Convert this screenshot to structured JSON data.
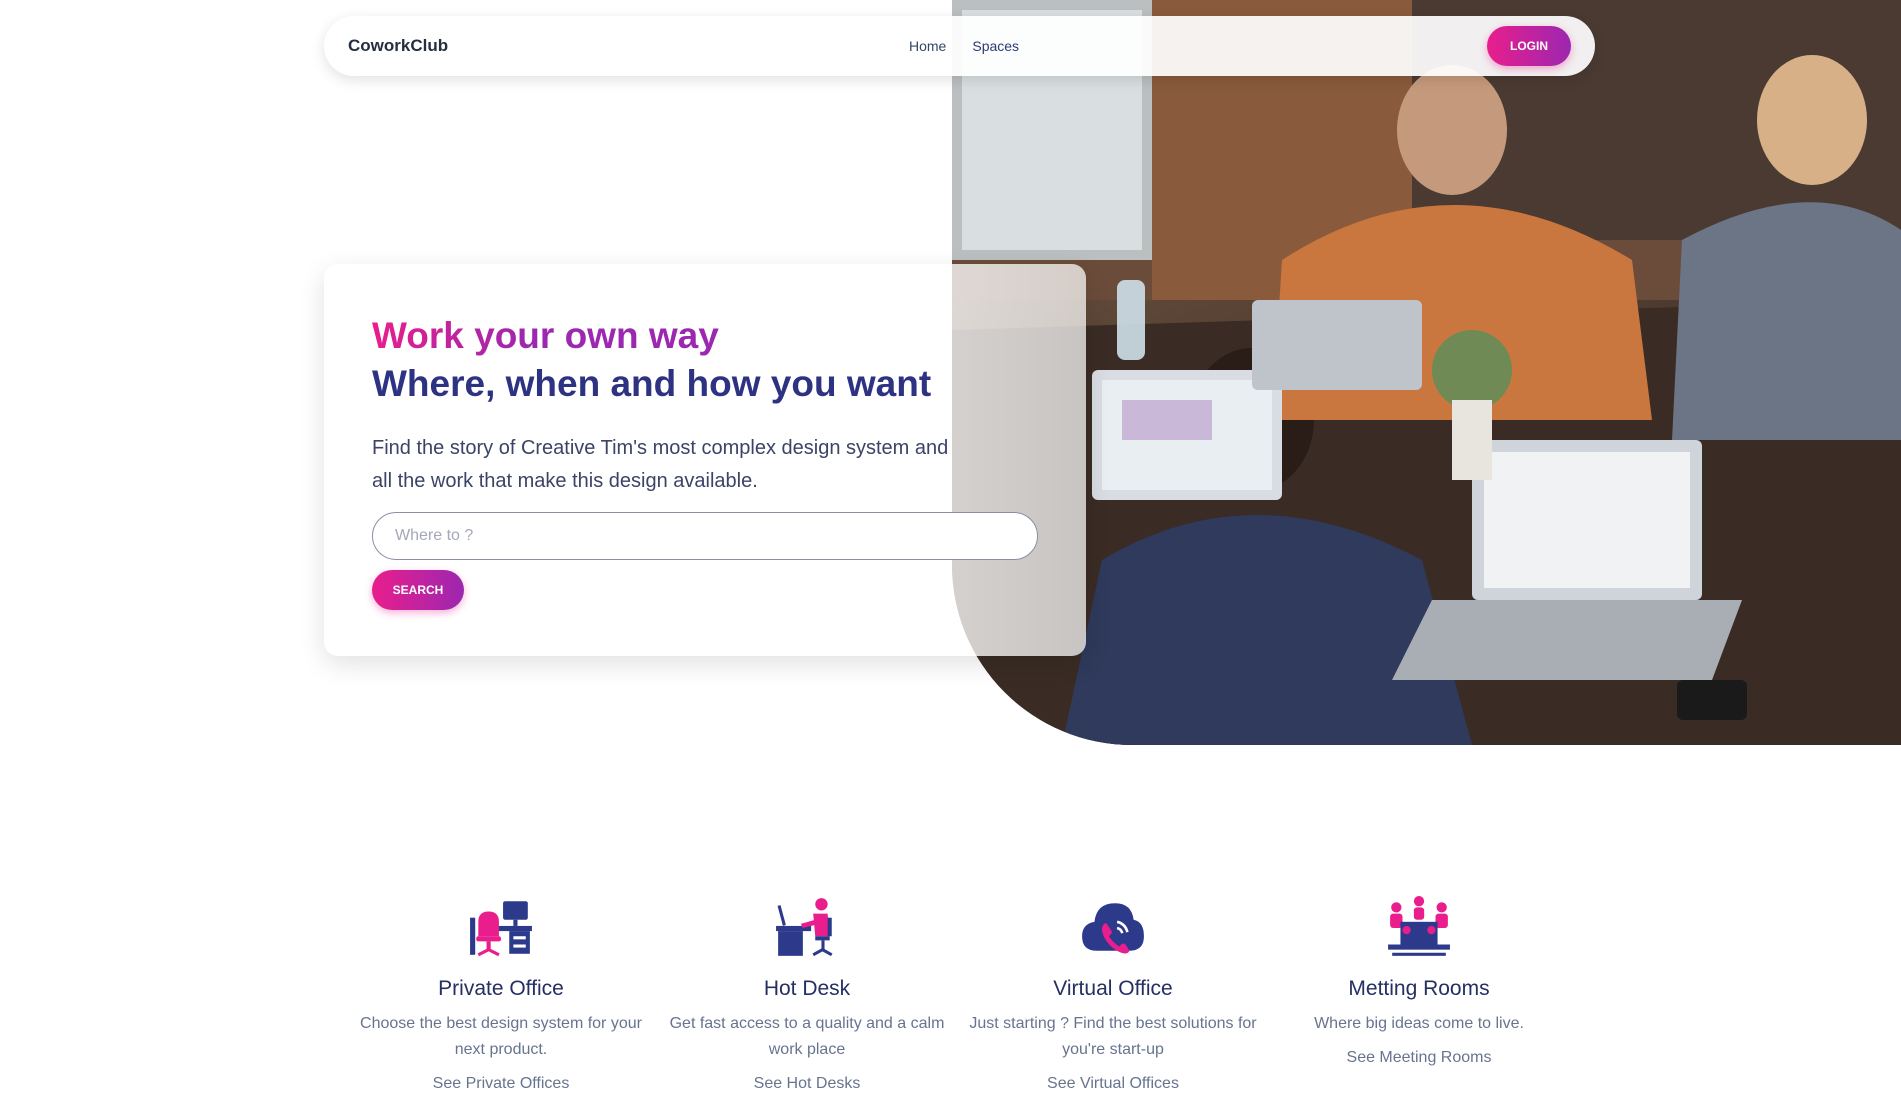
{
  "nav": {
    "brand": "CoworkClub",
    "links": [
      "Home",
      "Spaces"
    ],
    "login": "LOGIN"
  },
  "hero": {
    "title_line1": "Work your own way",
    "title_line2": "Where, when and how you want",
    "subtitle": "Find the story of Creative Tim's most complex design system and all the work that make this design available.",
    "search_placeholder": "Where to ?",
    "search_button": "SEARCH"
  },
  "features": [
    {
      "title": "Private Office",
      "desc": "Choose the best design system for your next product.",
      "link": "See Private Offices",
      "icon": "office-desk-icon"
    },
    {
      "title": "Hot Desk",
      "desc": "Get fast access to a quality and a calm work place",
      "link": "See Hot Desks",
      "icon": "hot-desk-icon"
    },
    {
      "title": "Virtual Office",
      "desc": "Just starting ? Find the best solutions for you're start-up",
      "link": "See Virtual Offices",
      "icon": "cloud-phone-icon"
    },
    {
      "title": "Metting Rooms",
      "desc": "Where big ideas come to live.",
      "link": "See Meeting Rooms",
      "icon": "meeting-room-icon"
    }
  ],
  "colors": {
    "accent_pink": "#e91e8c",
    "accent_purple": "#9c27b0",
    "navy": "#2d3382",
    "icon_blue": "#2d3a8c"
  }
}
